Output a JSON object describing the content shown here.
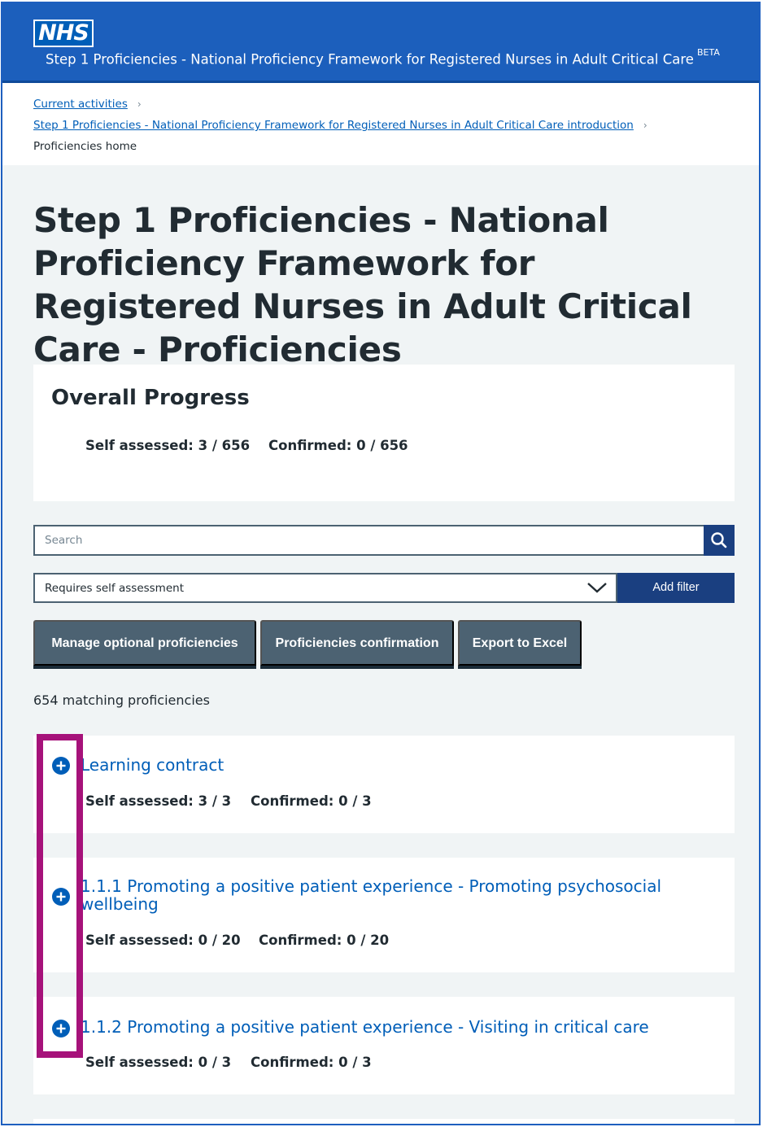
{
  "header": {
    "logo_text": "NHS",
    "service_name": "Step 1 Proficiencies - National Proficiency Framework for Registered Nurses in Adult Critical Care",
    "beta_tag": "BETA"
  },
  "breadcrumb": {
    "items": [
      {
        "label": "Current activities"
      },
      {
        "label": "Step 1 Proficiencies - National Proficiency Framework for Registered Nurses in Adult Critical Care introduction"
      },
      {
        "label": "Proficiencies home"
      }
    ],
    "separator": "›"
  },
  "page": {
    "title": "Step 1 Proficiencies - National Proficiency Framework for Registered Nurses in Adult Critical Care - Proficiencies"
  },
  "overall_progress": {
    "title": "Overall Progress",
    "self_assessed": "Self assessed: 3 / 656",
    "confirmed": "Confirmed: 0 / 656"
  },
  "search": {
    "placeholder": "Search",
    "button_icon": "search-icon"
  },
  "filter": {
    "selected": "Requires self assessment",
    "add_label": "Add filter"
  },
  "actions": {
    "manage_optional": "Manage optional proficiencies",
    "confirmation": "Proficiencies confirmation",
    "export": "Export to Excel"
  },
  "results": {
    "count_text": "654 matching proficiencies"
  },
  "sections": [
    {
      "title": "Learning contract",
      "self_assessed": "Self assessed: 3 / 3",
      "confirmed": "Confirmed: 0 / 3"
    },
    {
      "title": "1.1.1 Promoting a positive patient experience - Promoting psychosocial wellbeing",
      "self_assessed": "Self assessed: 0 / 20",
      "confirmed": "Confirmed: 0 / 20"
    },
    {
      "title": "1.1.2 Promoting a positive patient experience - Visiting in critical care",
      "self_assessed": "Self assessed: 0 / 3",
      "confirmed": "Confirmed: 0 / 3"
    }
  ],
  "colors": {
    "header_blue": "#1c5fbc",
    "link_blue": "#005eb8",
    "dark_button": "#1a3f80",
    "secondary_button": "#4c6272",
    "highlight": "#a6127a"
  }
}
